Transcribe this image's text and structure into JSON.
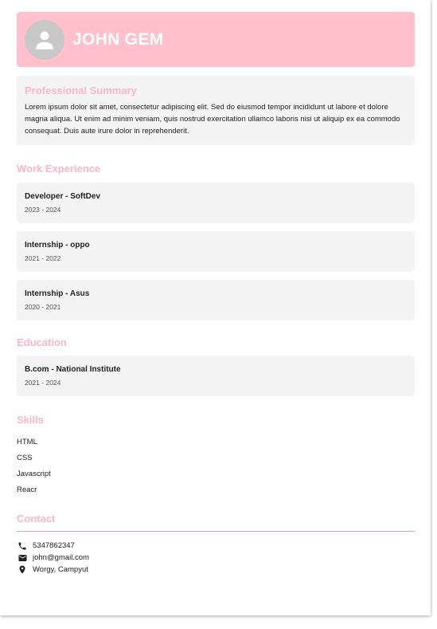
{
  "header": {
    "name": "JOHN GEM",
    "avatar_icon": "person-icon",
    "color": "#ffc0cb"
  },
  "summary": {
    "title": "Professional Summary",
    "text": "Lorem ipsum dolor sit amet, consectetur adipiscing elit. Sed do eiusmod tempor incididunt ut labore et dolore magna aliqua. Ut enim ad minim veniam, quis nostrud exercitation ullamco laboris nisi ut aliquip ex ea commodo consequat. Duis aute irure dolor in reprehenderit."
  },
  "experience": {
    "title": "Work Experience",
    "items": [
      {
        "title": "Developer - SoftDev",
        "dates": "2023 - 2024"
      },
      {
        "title": "Internship - oppo",
        "dates": "2021 - 2022"
      },
      {
        "title": "Internship - Asus",
        "dates": "2020 - 2021"
      }
    ]
  },
  "education": {
    "title": "Education",
    "items": [
      {
        "title": "B.com - National Institute",
        "dates": "2021 - 2024"
      }
    ]
  },
  "skills": {
    "title": "Skills",
    "items": [
      "HTML",
      "CSS",
      "Javascript",
      "Reacr"
    ]
  },
  "contact": {
    "title": "Contact",
    "phone": "5347862347",
    "email": "john@gmail.com",
    "address": "Worgy, Campyut",
    "icons": [
      "phone-icon",
      "mail-icon",
      "location-icon"
    ]
  },
  "colors": {
    "accent": "#ffb6c4",
    "card_bg": "#f4f4f4"
  }
}
